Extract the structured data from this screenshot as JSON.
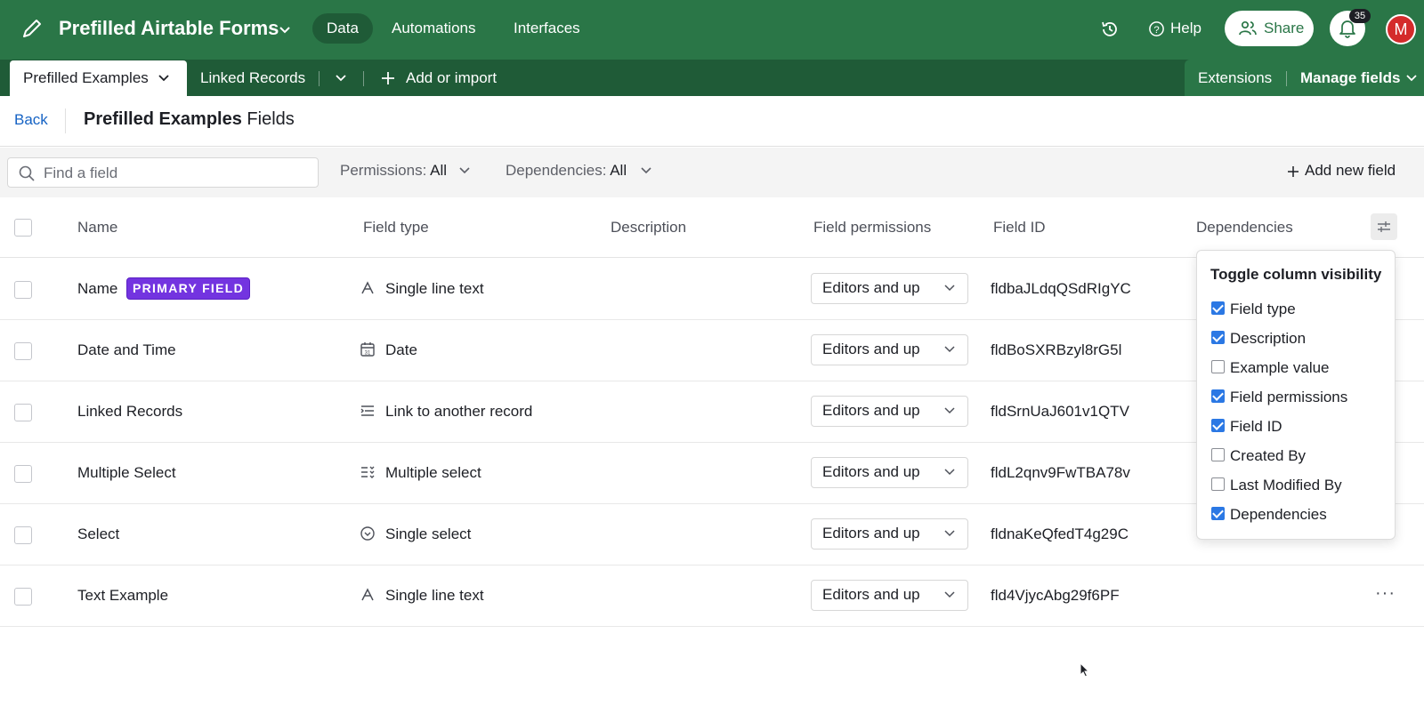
{
  "header": {
    "base_title": "Prefilled Airtable Forms",
    "nav": [
      "Data",
      "Automations",
      "Interfaces"
    ],
    "help_label": "Help",
    "share_label": "Share",
    "notification_count": "35",
    "avatar_initial": "M",
    "brand_color": "#2a7647"
  },
  "tabs": {
    "active": "Prefilled Examples",
    "linked": "Linked Records",
    "add_label": "Add or import",
    "extensions": "Extensions",
    "manage_fields": "Manage fields"
  },
  "page": {
    "back": "Back",
    "title_bold": "Prefilled Examples",
    "title_rest": " Fields"
  },
  "toolbar": {
    "search_placeholder": "Find a field",
    "permissions_label": "Permissions:",
    "permissions_value": "All",
    "dependencies_label": "Dependencies:",
    "dependencies_value": "All",
    "add_field": "Add new field"
  },
  "table": {
    "columns": [
      "Name",
      "Field type",
      "Description",
      "Field permissions",
      "Field ID",
      "Dependencies"
    ],
    "primary_badge": "PRIMARY FIELD",
    "rows": [
      {
        "name": "Name",
        "type": "Single line text",
        "type_icon": "text-icon",
        "permission": "Editors and up",
        "field_id": "fldbaJLdqQSdRIgYC"
      },
      {
        "name": "Date and Time",
        "type": "Date",
        "type_icon": "calendar-icon",
        "permission": "Editors and up",
        "field_id": "fldBoSXRBzyl8rG5l"
      },
      {
        "name": "Linked Records",
        "type": "Link to another record",
        "type_icon": "link-record-icon",
        "permission": "Editors and up",
        "field_id": "fldSrnUaJ601v1QTV"
      },
      {
        "name": "Multiple Select",
        "type": "Multiple select",
        "type_icon": "multi-select-icon",
        "permission": "Editors and up",
        "field_id": "fldL2qnv9FwTBA78v"
      },
      {
        "name": "Select",
        "type": "Single select",
        "type_icon": "single-select-icon",
        "permission": "Editors and up",
        "field_id": "fldnaKeQfedT4g29C"
      },
      {
        "name": "Text Example",
        "type": "Single line text",
        "type_icon": "text-icon",
        "permission": "Editors and up",
        "field_id": "fld4VjycAbg29f6PF"
      }
    ]
  },
  "popover": {
    "title": "Toggle column visibility",
    "options": [
      {
        "label": "Field type",
        "checked": true
      },
      {
        "label": "Description",
        "checked": true
      },
      {
        "label": "Example value",
        "checked": false
      },
      {
        "label": "Field permissions",
        "checked": true
      },
      {
        "label": "Field ID",
        "checked": true
      },
      {
        "label": "Created By",
        "checked": false
      },
      {
        "label": "Last Modified By",
        "checked": false
      },
      {
        "label": "Dependencies",
        "checked": true
      }
    ]
  }
}
